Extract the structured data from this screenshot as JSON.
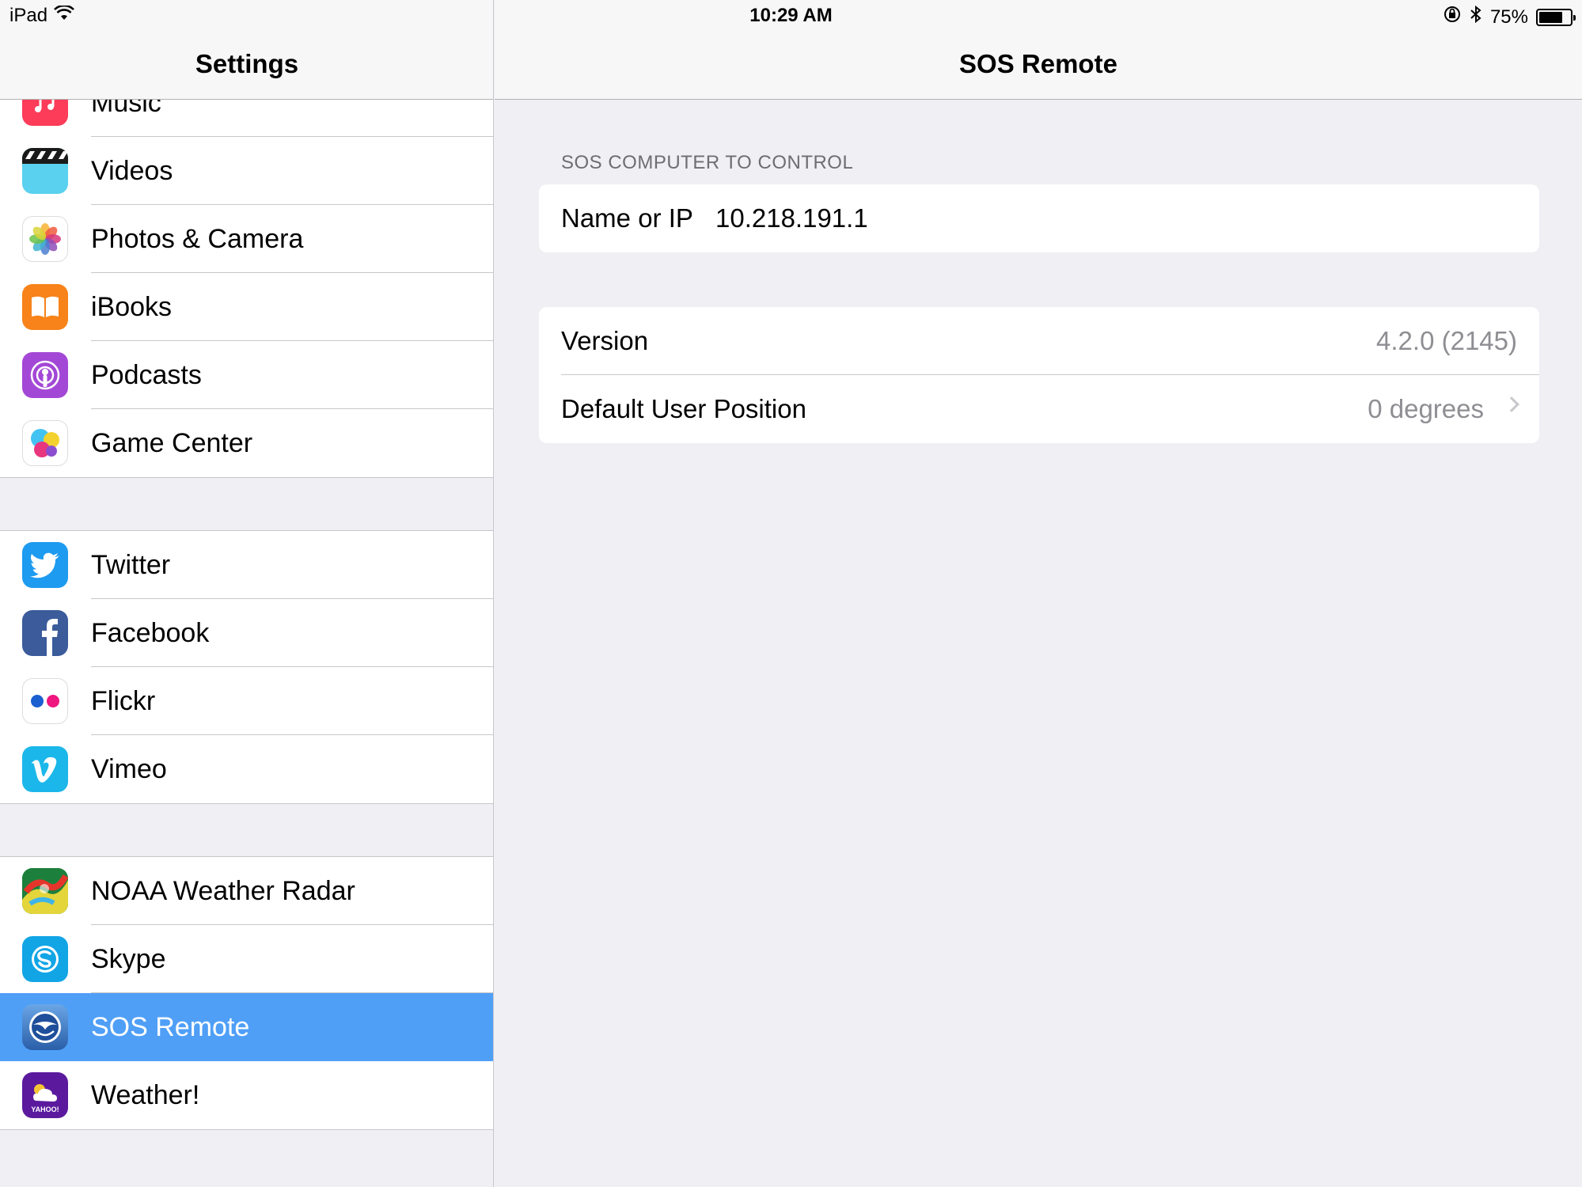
{
  "status_bar": {
    "device": "iPad",
    "time": "10:29 AM",
    "battery_percent": "75%",
    "battery_level": 0.75,
    "icons": [
      "wifi-icon",
      "rotation-lock-icon",
      "bluetooth-icon",
      "battery-icon"
    ]
  },
  "left": {
    "title": "Settings",
    "group1": [
      {
        "label": "Music",
        "icon": "music-icon",
        "color": "#fc3c59"
      },
      {
        "label": "Videos",
        "icon": "videos-icon",
        "color": "#5ad1ef"
      },
      {
        "label": "Photos & Camera",
        "icon": "photos-icon",
        "color": "#ffffff"
      },
      {
        "label": "iBooks",
        "icon": "ibooks-icon",
        "color": "#f7831a"
      },
      {
        "label": "Podcasts",
        "icon": "podcasts-icon",
        "color": "#a348d6"
      },
      {
        "label": "Game Center",
        "icon": "game-center-icon",
        "color": "#ffffff"
      }
    ],
    "group2": [
      {
        "label": "Twitter",
        "icon": "twitter-icon",
        "color": "#1d9bf0"
      },
      {
        "label": "Facebook",
        "icon": "facebook-icon",
        "color": "#3b5b9a"
      },
      {
        "label": "Flickr",
        "icon": "flickr-icon",
        "color": "#ffffff"
      },
      {
        "label": "Vimeo",
        "icon": "vimeo-icon",
        "color": "#1bb7ea"
      }
    ],
    "group3": [
      {
        "label": "NOAA Weather Radar",
        "icon": "noaa-weather-radar-icon",
        "color": "#2aa34a"
      },
      {
        "label": "Skype",
        "icon": "skype-icon",
        "color": "#12a5e6"
      },
      {
        "label": "SOS Remote",
        "icon": "sos-remote-icon",
        "color": "#3a7bc8",
        "selected": true
      },
      {
        "label": "Weather!",
        "icon": "yahoo-weather-icon",
        "color": "#5b1a9e"
      }
    ],
    "yahoo_text": "YAHOO!"
  },
  "right": {
    "title": "SOS Remote",
    "section_header": "SOS COMPUTER TO CONTROL",
    "name_label": "Name or IP",
    "name_value": "10.218.191.1",
    "version_label": "Version",
    "version_value": "4.2.0 (2145)",
    "position_label": "Default User Position",
    "position_value": "0 degrees"
  },
  "colors": {
    "selection": "#4f9ff7",
    "secondary_text": "#8e8e93"
  }
}
